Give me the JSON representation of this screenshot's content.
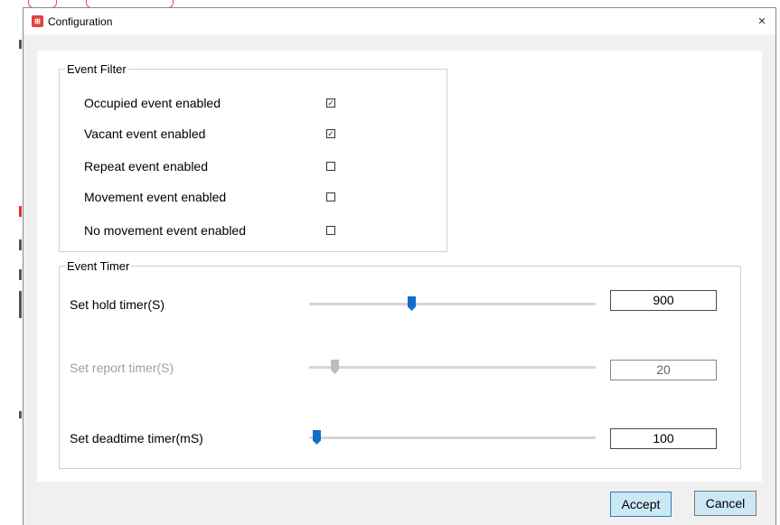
{
  "window": {
    "title": "Configuration",
    "close_glyph": "×",
    "icon": "app-logo-icon"
  },
  "event_filter": {
    "legend": "Event Filter",
    "items": [
      {
        "label": "Occupied event enabled",
        "checked": true
      },
      {
        "label": "Vacant event enabled",
        "checked": true
      },
      {
        "label": "Repeat event enabled",
        "checked": false
      },
      {
        "label": "Movement event enabled",
        "checked": false
      },
      {
        "label": "No movement event enabled",
        "checked": false
      }
    ]
  },
  "event_timer": {
    "legend": "Event Timer",
    "hold": {
      "label": "Set hold timer(S)",
      "value": "900",
      "enabled": true
    },
    "report": {
      "label": "Set report timer(S)",
      "value": "20",
      "enabled": false
    },
    "deadtime": {
      "label": "Set deadtime timer(mS)",
      "value": "100",
      "enabled": true
    }
  },
  "buttons": {
    "accept": "Accept",
    "cancel": "Cancel"
  },
  "colors": {
    "slider_thumb": "#0f6ec6",
    "slider_thumb_disabled": "#bdbdbd",
    "button_bg": "#cce8f4"
  }
}
